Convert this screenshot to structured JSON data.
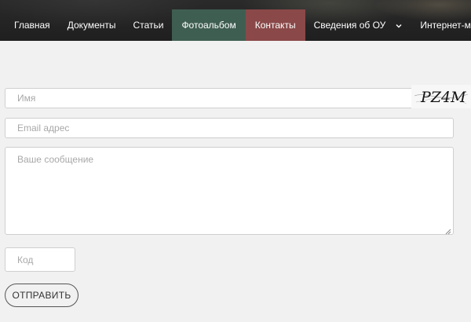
{
  "nav": {
    "items": [
      {
        "label": "Главная"
      },
      {
        "label": "Документы"
      },
      {
        "label": "Статьи"
      },
      {
        "label": "Фотоальбом"
      },
      {
        "label": "Контакты"
      },
      {
        "label": "Сведения об ОУ"
      },
      {
        "label": "Интернет-магазин"
      }
    ],
    "colors": {
      "photo_bg": "#3f5e52",
      "contacts_bg": "#8a4848"
    }
  },
  "form": {
    "name_placeholder": "Имя",
    "email_placeholder": "Email адрес",
    "message_placeholder": "Ваше сообщение",
    "code_placeholder": "Код",
    "captcha_text": "PZ4M",
    "submit_label": "ОТПРАВИТЬ"
  }
}
